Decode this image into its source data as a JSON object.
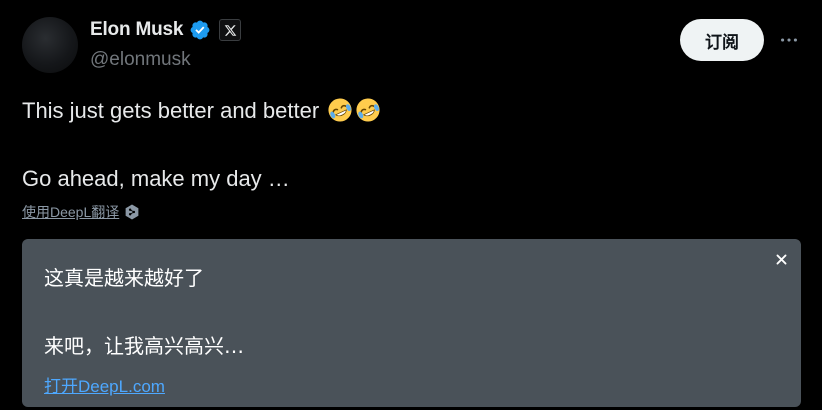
{
  "author": {
    "display_name": "Elon Musk",
    "handle": "@elonmusk",
    "verified": true,
    "affiliate_badge": "x-logo-icon"
  },
  "actions": {
    "subscribe_label": "订阅",
    "more_icon": "more-dots-icon"
  },
  "tweet": {
    "line1": "This just gets better and better",
    "line1_emoji": [
      "rolling-on-floor-laughing-emoji",
      "rolling-on-floor-laughing-emoji"
    ],
    "line2": "Go ahead, make my day …"
  },
  "translate": {
    "link_label": "使用DeepL翻译",
    "icon": "deepl-icon"
  },
  "translation": {
    "line1": "这真是越来越好了",
    "line2": "来吧，让我高兴高兴…",
    "open_link": "打开DeepL.com",
    "close_icon": "close-icon"
  },
  "colors": {
    "background": "#000000",
    "text_primary": "#e7e9ea",
    "text_secondary": "#71767b",
    "verified_blue": "#1d9bf0",
    "translation_card_bg": "#4a5259",
    "link_blue": "#4ea8ff",
    "subscribe_bg": "#eff3f4"
  }
}
